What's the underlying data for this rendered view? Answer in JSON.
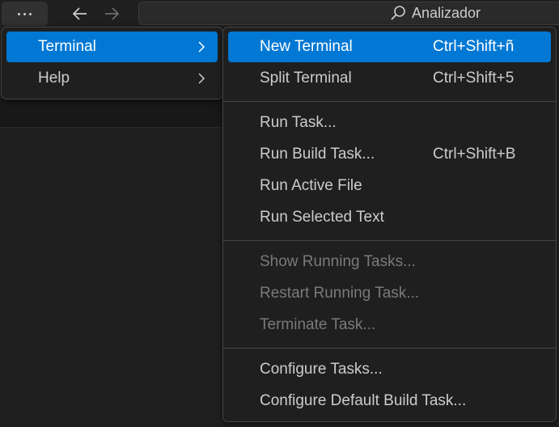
{
  "titlebar": {
    "more_icon": "ellipsis-icon",
    "back_icon": "arrow-left-icon",
    "forward_icon": "arrow-right-icon",
    "search_icon": "search-icon",
    "search_text": "Analizador"
  },
  "main_menu": {
    "items": [
      {
        "label": "Terminal",
        "active": true,
        "submenu_icon": "chevron-right-icon"
      },
      {
        "label": "Help",
        "active": false,
        "submenu_icon": "chevron-right-icon"
      }
    ]
  },
  "terminal_menu": {
    "groups": [
      [
        {
          "label": "New Terminal",
          "keybinding": "Ctrl+Shift+ñ",
          "active": true
        },
        {
          "label": "Split Terminal",
          "keybinding": "Ctrl+Shift+5"
        }
      ],
      [
        {
          "label": "Run Task...",
          "keybinding": ""
        },
        {
          "label": "Run Build Task...",
          "keybinding": "Ctrl+Shift+B"
        },
        {
          "label": "Run Active File",
          "keybinding": ""
        },
        {
          "label": "Run Selected Text",
          "keybinding": ""
        }
      ],
      [
        {
          "label": "Show Running Tasks...",
          "keybinding": "",
          "disabled": true
        },
        {
          "label": "Restart Running Task...",
          "keybinding": "",
          "disabled": true
        },
        {
          "label": "Terminate Task...",
          "keybinding": "",
          "disabled": true
        }
      ],
      [
        {
          "label": "Configure Tasks...",
          "keybinding": ""
        },
        {
          "label": "Configure Default Build Task...",
          "keybinding": ""
        }
      ]
    ]
  },
  "colors": {
    "accent": "#0078d4",
    "background": "#1f1f1f",
    "menu_border": "#454545",
    "text": "#cccccc",
    "disabled_text": "#7a7a7a"
  }
}
